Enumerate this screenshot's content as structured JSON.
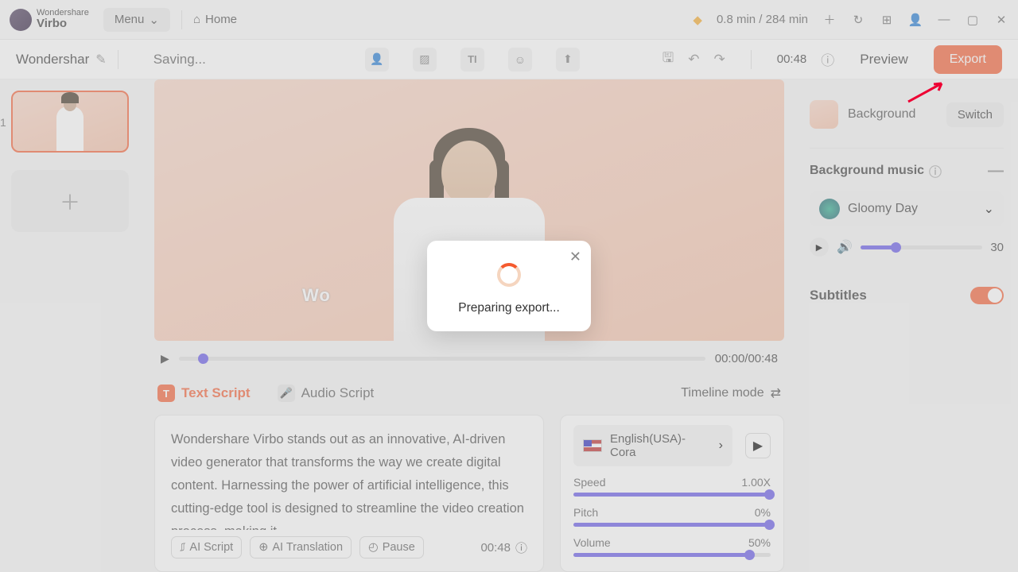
{
  "topbar": {
    "brand_line1": "Wondershare",
    "brand_line2": "Virbo",
    "menu_label": "Menu",
    "home_label": "Home",
    "minutes_text": "0.8 min / 284 min"
  },
  "toolbar": {
    "project_name": "Wondershar",
    "saving_label": "Saving...",
    "duration": "00:48",
    "preview_label": "Preview",
    "export_label": "Export"
  },
  "slides": {
    "number": "1"
  },
  "canvas": {
    "watermark_visible": "Wo"
  },
  "playback": {
    "time_display": "00:00/00:48"
  },
  "tabs": {
    "text_script": "Text Script",
    "audio_script": "Audio Script",
    "timeline_mode": "Timeline mode"
  },
  "script": {
    "text": "Wondershare Virbo stands out as an innovative, AI-driven video generator that transforms the way we create digital content. Harnessing the power of artificial intelligence, this cutting-edge tool is designed to streamline the video creation process, making it",
    "ai_script": "AI Script",
    "ai_translation": "AI Translation",
    "pause": "Pause",
    "duration": "00:48"
  },
  "voice": {
    "selected": "English(USA)-Cora",
    "speed_label": "Speed",
    "speed_value": "1.00X",
    "pitch_label": "Pitch",
    "pitch_value": "0%",
    "volume_label": "Volume",
    "volume_value": "50%"
  },
  "right": {
    "background_label": "Background",
    "switch_label": "Switch",
    "bgm_title": "Background music",
    "bgm_track": "Gloomy Day",
    "bgm_volume": "30",
    "subtitles_label": "Subtitles"
  },
  "modal": {
    "text": "Preparing export..."
  }
}
